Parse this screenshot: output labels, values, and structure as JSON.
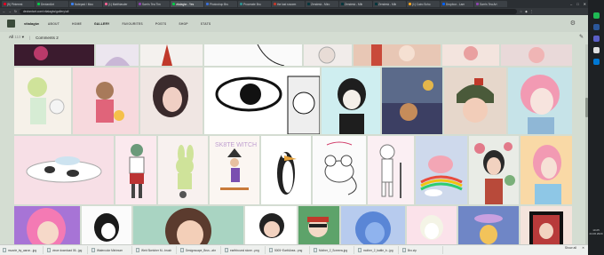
{
  "tabs": [
    {
      "label": "(5) Pinterest",
      "active": false
    },
    {
      "label": "DeviantArt",
      "active": false
    },
    {
      "label": "Notepad / Mou",
      "active": false
    },
    {
      "label": "(1) Matthiasder",
      "active": false
    },
    {
      "label": "Sam's Tea Tim",
      "active": false
    },
    {
      "label": "vitalagiw - Yes",
      "active": true
    },
    {
      "label": "Photoshop Bru",
      "active": false
    },
    {
      "label": "Procreate Bru",
      "active": false
    },
    {
      "label": "the last snowm",
      "active": false
    },
    {
      "label": "Zendesk - Miro",
      "active": false
    },
    {
      "label": "Zendesk - Mib",
      "active": false
    },
    {
      "label": "Zendesk - Mib",
      "active": false
    },
    {
      "label": "(1) Cairo Scho",
      "active": false
    },
    {
      "label": "Dropbox - Lam",
      "active": false
    },
    {
      "label": "Sam's Tea Art",
      "active": false
    }
  ],
  "address": {
    "url": "deviantart.com/vitalagiw/gallery/all"
  },
  "site": {
    "username": "vitalagiw",
    "nav": [
      "ABOUT",
      "HOME",
      "GALLERY",
      "FAVOURITES",
      "POSTS",
      "SHOP",
      "STATS"
    ],
    "selected_nav": "GALLERY"
  },
  "toolbar": {
    "all_label": "All",
    "all_count": "110",
    "sep": "|",
    "comments_label": "Comments",
    "comments_count": "2"
  },
  "downloads": [
    "muzzle_by_aaron...jpg",
    "vince download 05...jpg",
    "Watercolor Minimum",
    "Web Sketcher M...brush",
    "Designscape_Brus...abr",
    "earthbound stone...png",
    "5005~EarthArea...png",
    "Mother_2_Screens.jpg",
    "mother_2_battle_b...jpg",
    "Bro.zip"
  ],
  "showall_label": "Show all",
  "clock": {
    "time": "10:25",
    "date": "24.06.2020"
  },
  "colors": {
    "accent": "#05cc47",
    "page_bg": "#d4ddd2",
    "tab_bg": "#2b2f33"
  }
}
